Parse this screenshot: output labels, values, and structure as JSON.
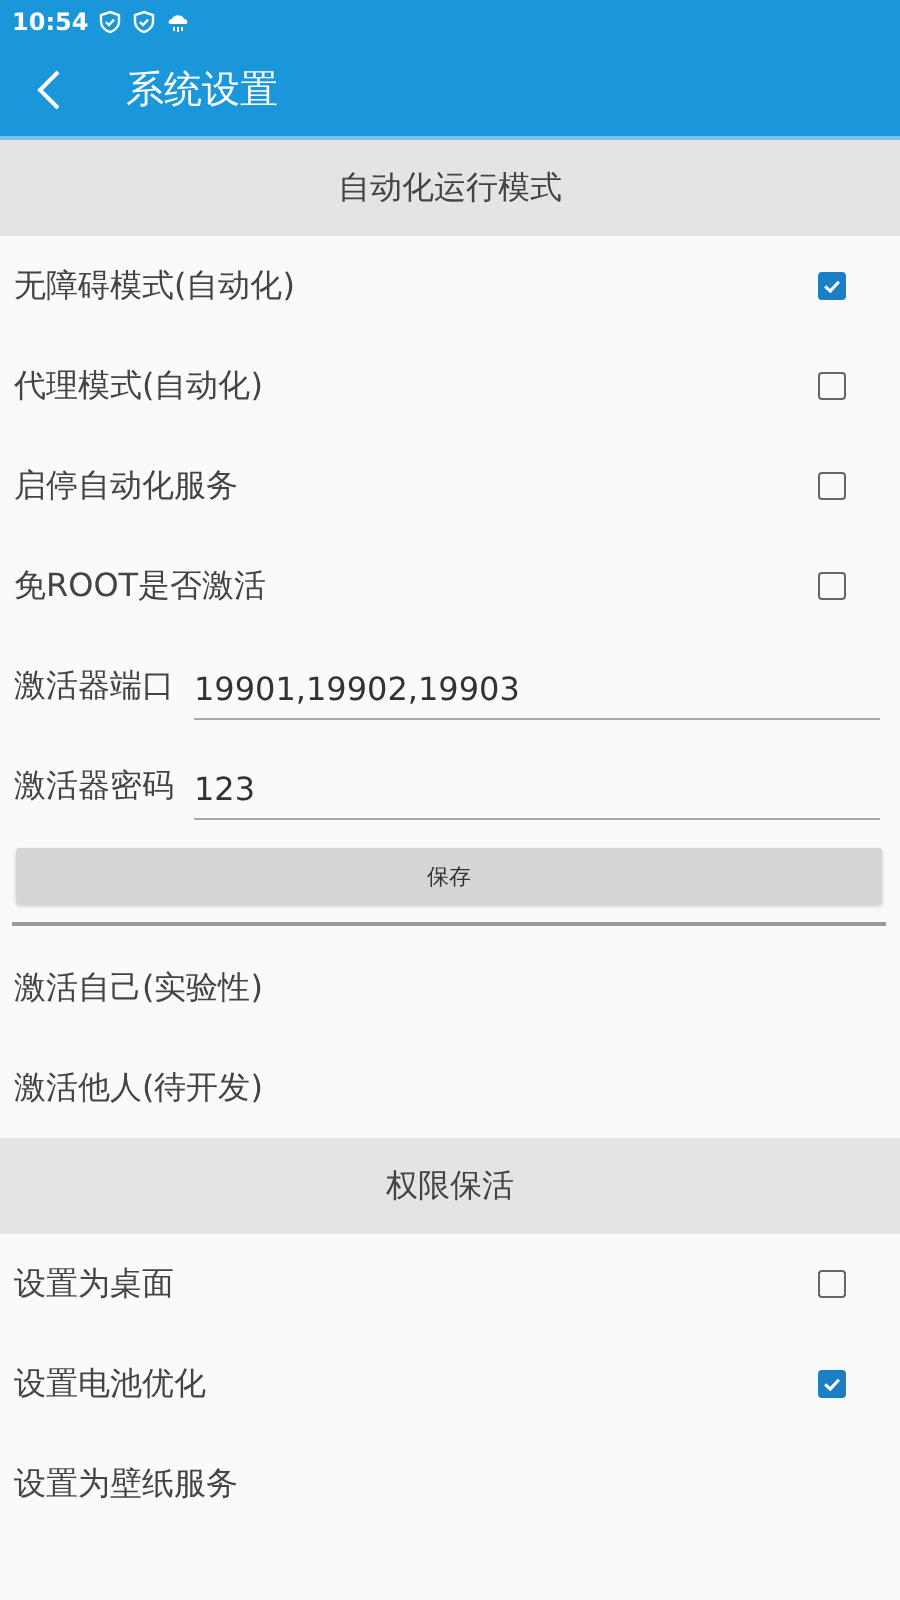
{
  "status_bar": {
    "time": "10:54"
  },
  "app_bar": {
    "title": "系统设置"
  },
  "sections": [
    {
      "title": "自动化运行模式",
      "items": [
        {
          "kind": "checkbox",
          "label": "无障碍模式(自动化)",
          "checked": true
        },
        {
          "kind": "checkbox",
          "label": "代理模式(自动化)",
          "checked": false
        },
        {
          "kind": "checkbox",
          "label": "启停自动化服务",
          "checked": false
        },
        {
          "kind": "checkbox",
          "label": "免ROOT是否激活",
          "checked": false
        },
        {
          "kind": "field",
          "label": "激活器端口",
          "value": "19901,19902,19903"
        },
        {
          "kind": "field",
          "label": "激活器密码",
          "value": "123"
        },
        {
          "kind": "button",
          "label": "保存"
        },
        {
          "kind": "divider"
        },
        {
          "kind": "text",
          "label": "激活自己(实验性)"
        },
        {
          "kind": "text",
          "label": "激活他人(待开发)"
        }
      ]
    },
    {
      "title": "权限保活",
      "items": [
        {
          "kind": "checkbox",
          "label": "设置为桌面",
          "checked": false
        },
        {
          "kind": "checkbox",
          "label": "设置电池优化",
          "checked": true
        },
        {
          "kind": "text",
          "label": "设置为壁纸服务"
        }
      ]
    }
  ]
}
